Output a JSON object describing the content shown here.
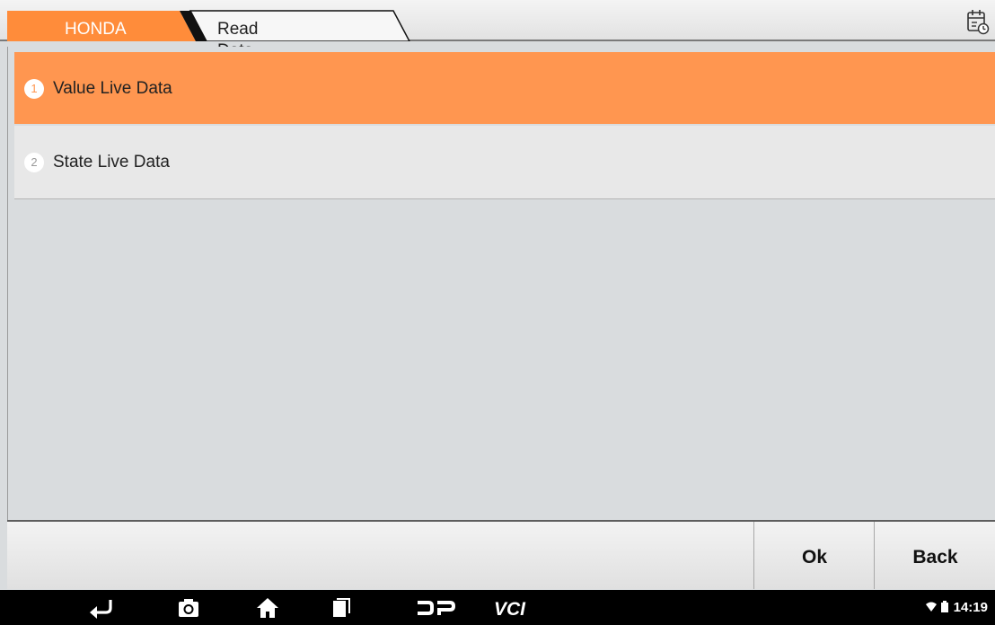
{
  "breadcrumb": {
    "brand": "HONDA",
    "page": "Read Data Stream"
  },
  "header": {
    "report_icon": "calendar-report-icon"
  },
  "menu": {
    "items": [
      {
        "number": "1",
        "label": "Value Live Data",
        "selected": true
      },
      {
        "number": "2",
        "label": "State Live Data",
        "selected": false
      }
    ]
  },
  "actions": {
    "ok_label": "Ok",
    "back_label": "Back"
  },
  "navbar": {
    "icons": [
      "back-icon",
      "camera-icon",
      "home-icon",
      "recent-apps-icon",
      "dp-icon",
      "vci-icon"
    ],
    "time": "14:19"
  },
  "colors": {
    "accent": "#ff9650",
    "background": "#d9dcde"
  }
}
